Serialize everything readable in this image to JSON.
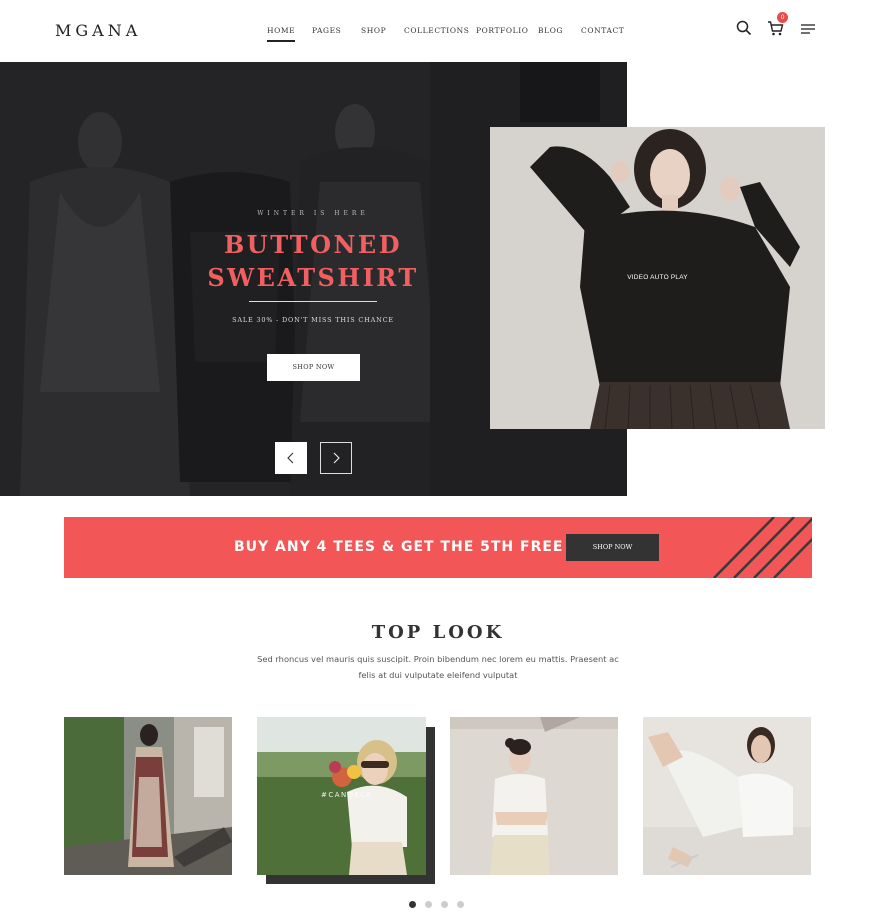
{
  "header": {
    "logo": "MGANA",
    "nav": [
      "HOME",
      "PAGES",
      "SHOP",
      "COLLECTIONS",
      "PORTFOLIO",
      "BLOG",
      "CONTACT"
    ],
    "active_nav": "HOME",
    "cart_count": "0",
    "icons": [
      "search-icon",
      "cart-icon",
      "menu-icon"
    ]
  },
  "hero": {
    "subtitle": "WINTER IS HERE",
    "title": "BUTTONED SWEATSHIRT",
    "description": "SALE 30% - DON'T MISS THIS CHANCE",
    "button": "SHOP NOW",
    "side_label": "VIDEO AUTO PLAY"
  },
  "promo": {
    "text": "BUY ANY 4 TEES & GET THE 5TH FREE",
    "button": "SHOP NOW",
    "color": "#f25656"
  },
  "top_look": {
    "title": "TOP LOOK",
    "description": "Sed rhoncus vel mauris quis suscipit. Proin bibendum nec lorem eu mattis. Praesent ac felis at dui vulputate eleifend vulputat",
    "photo_caption": "#CANDELA",
    "dots": 4,
    "active_dot": 0
  },
  "colors": {
    "accent": "#f06060",
    "dark": "#333333"
  }
}
